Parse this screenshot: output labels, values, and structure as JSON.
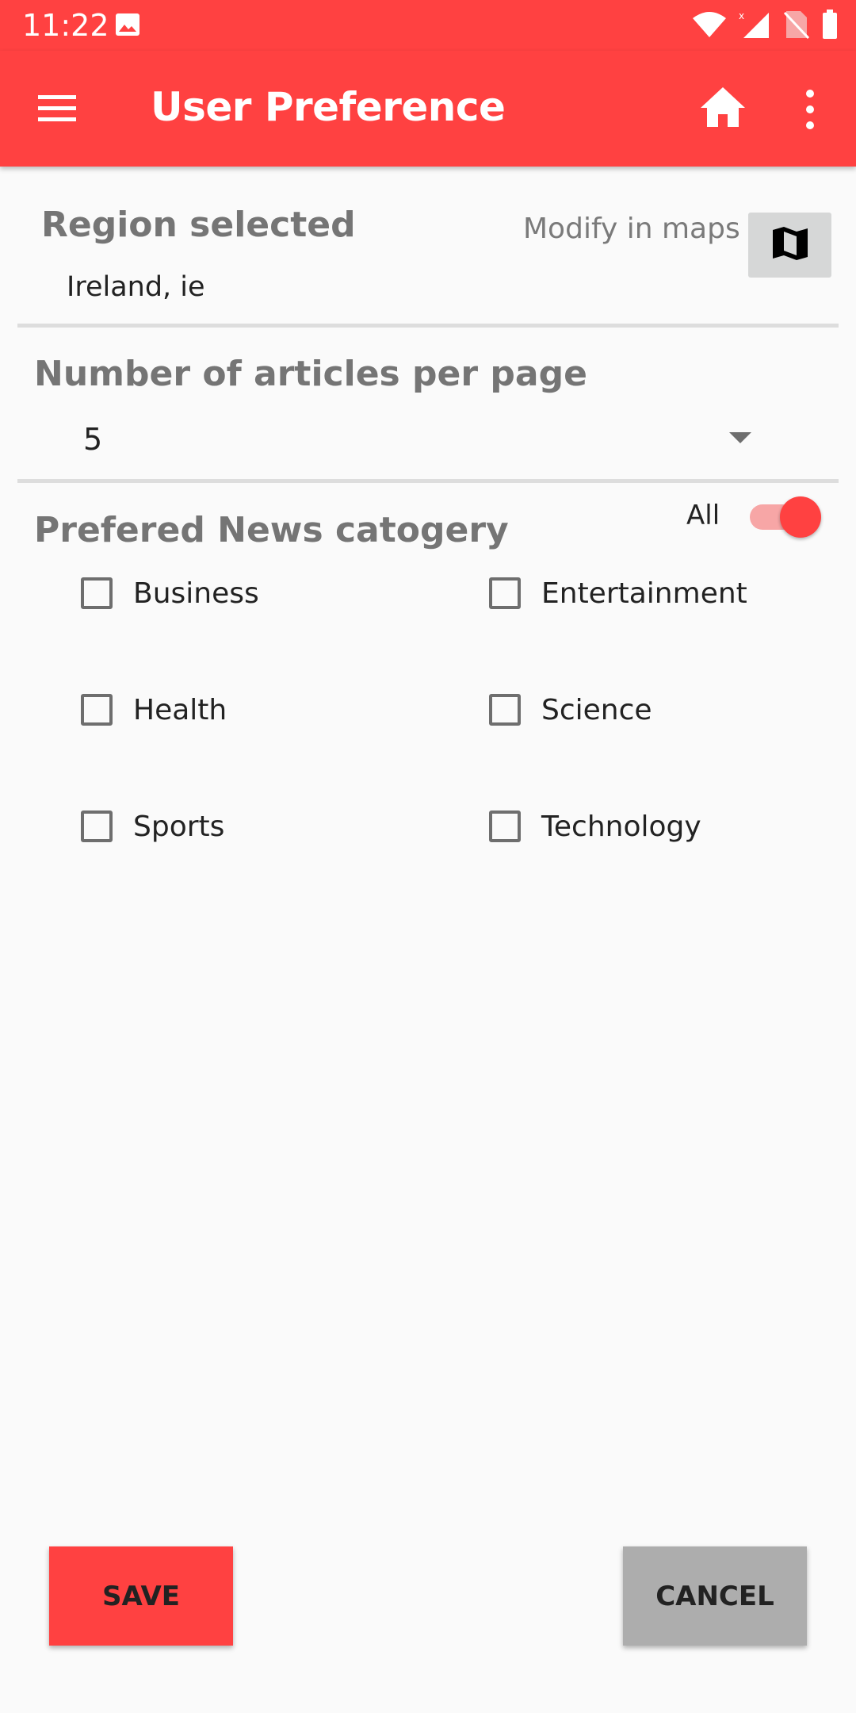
{
  "status_bar": {
    "time": "11:22"
  },
  "app_bar": {
    "title": "User Preference",
    "icons": [
      "menu-icon",
      "home-icon",
      "more-vert-icon"
    ]
  },
  "region": {
    "title": "Region selected",
    "modify_label": "Modify in maps",
    "value": "Ireland, ie",
    "map_icon": "map-icon"
  },
  "articles": {
    "title": "Number of articles per page",
    "selected": "5"
  },
  "categories": {
    "title": "Prefered News catogery",
    "all_label": "All",
    "all_toggle_on": true,
    "items": [
      {
        "label": "Business",
        "checked": false
      },
      {
        "label": "Entertainment",
        "checked": false
      },
      {
        "label": "Health",
        "checked": false
      },
      {
        "label": "Science",
        "checked": false
      },
      {
        "label": "Sports",
        "checked": false
      },
      {
        "label": "Technology",
        "checked": false
      }
    ]
  },
  "actions": {
    "save_label": "SAVE",
    "cancel_label": "CANCEL"
  },
  "colors": {
    "accent": "#ff4141",
    "cancel": "#adadad",
    "map_button": "#d6d7d7"
  }
}
